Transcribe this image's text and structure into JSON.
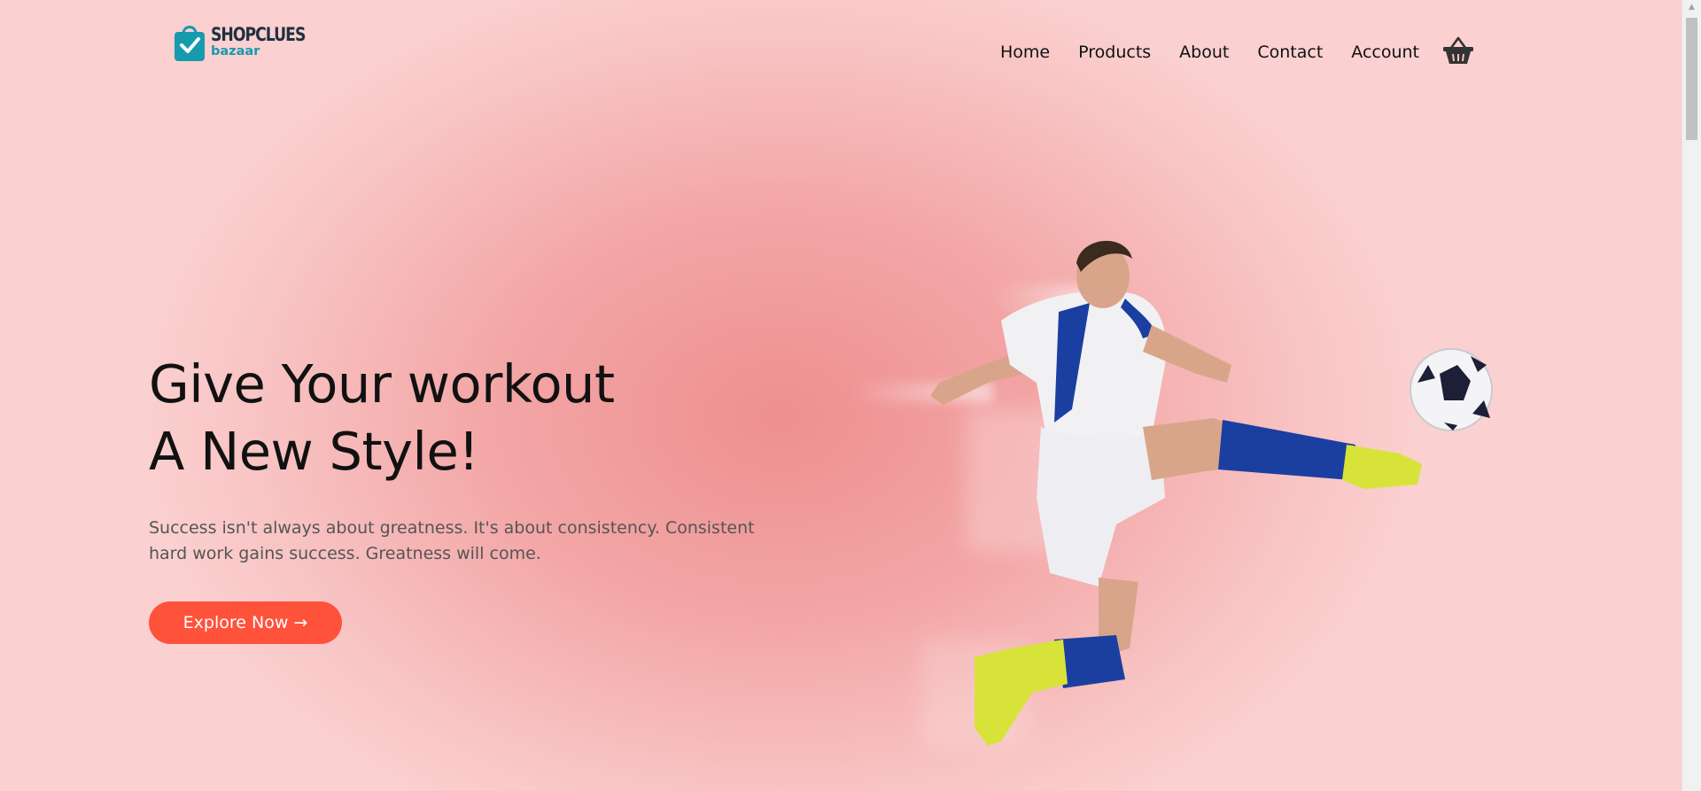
{
  "brand": {
    "name_top": "SHOPCLUES",
    "name_bottom": "bazaar"
  },
  "nav": {
    "items": [
      {
        "label": "Home"
      },
      {
        "label": "Products"
      },
      {
        "label": "About"
      },
      {
        "label": "Contact"
      },
      {
        "label": "Account"
      }
    ],
    "cart_icon": "basket-icon"
  },
  "hero": {
    "title_line1": "Give Your workout",
    "title_line2": "A New Style!",
    "subtitle": "Success isn't always about greatness. It's about consistency. Consistent hard work gains success. Greatness will come.",
    "button_label": "Explore Now →"
  },
  "colors": {
    "accent": "#ff523b",
    "brand_teal": "#169aae",
    "background": "#f3a6a6"
  },
  "icons": {
    "logo": "shopping-bag-check-icon",
    "cart": "basket-icon",
    "scroll_up": "triangle-up-icon"
  }
}
